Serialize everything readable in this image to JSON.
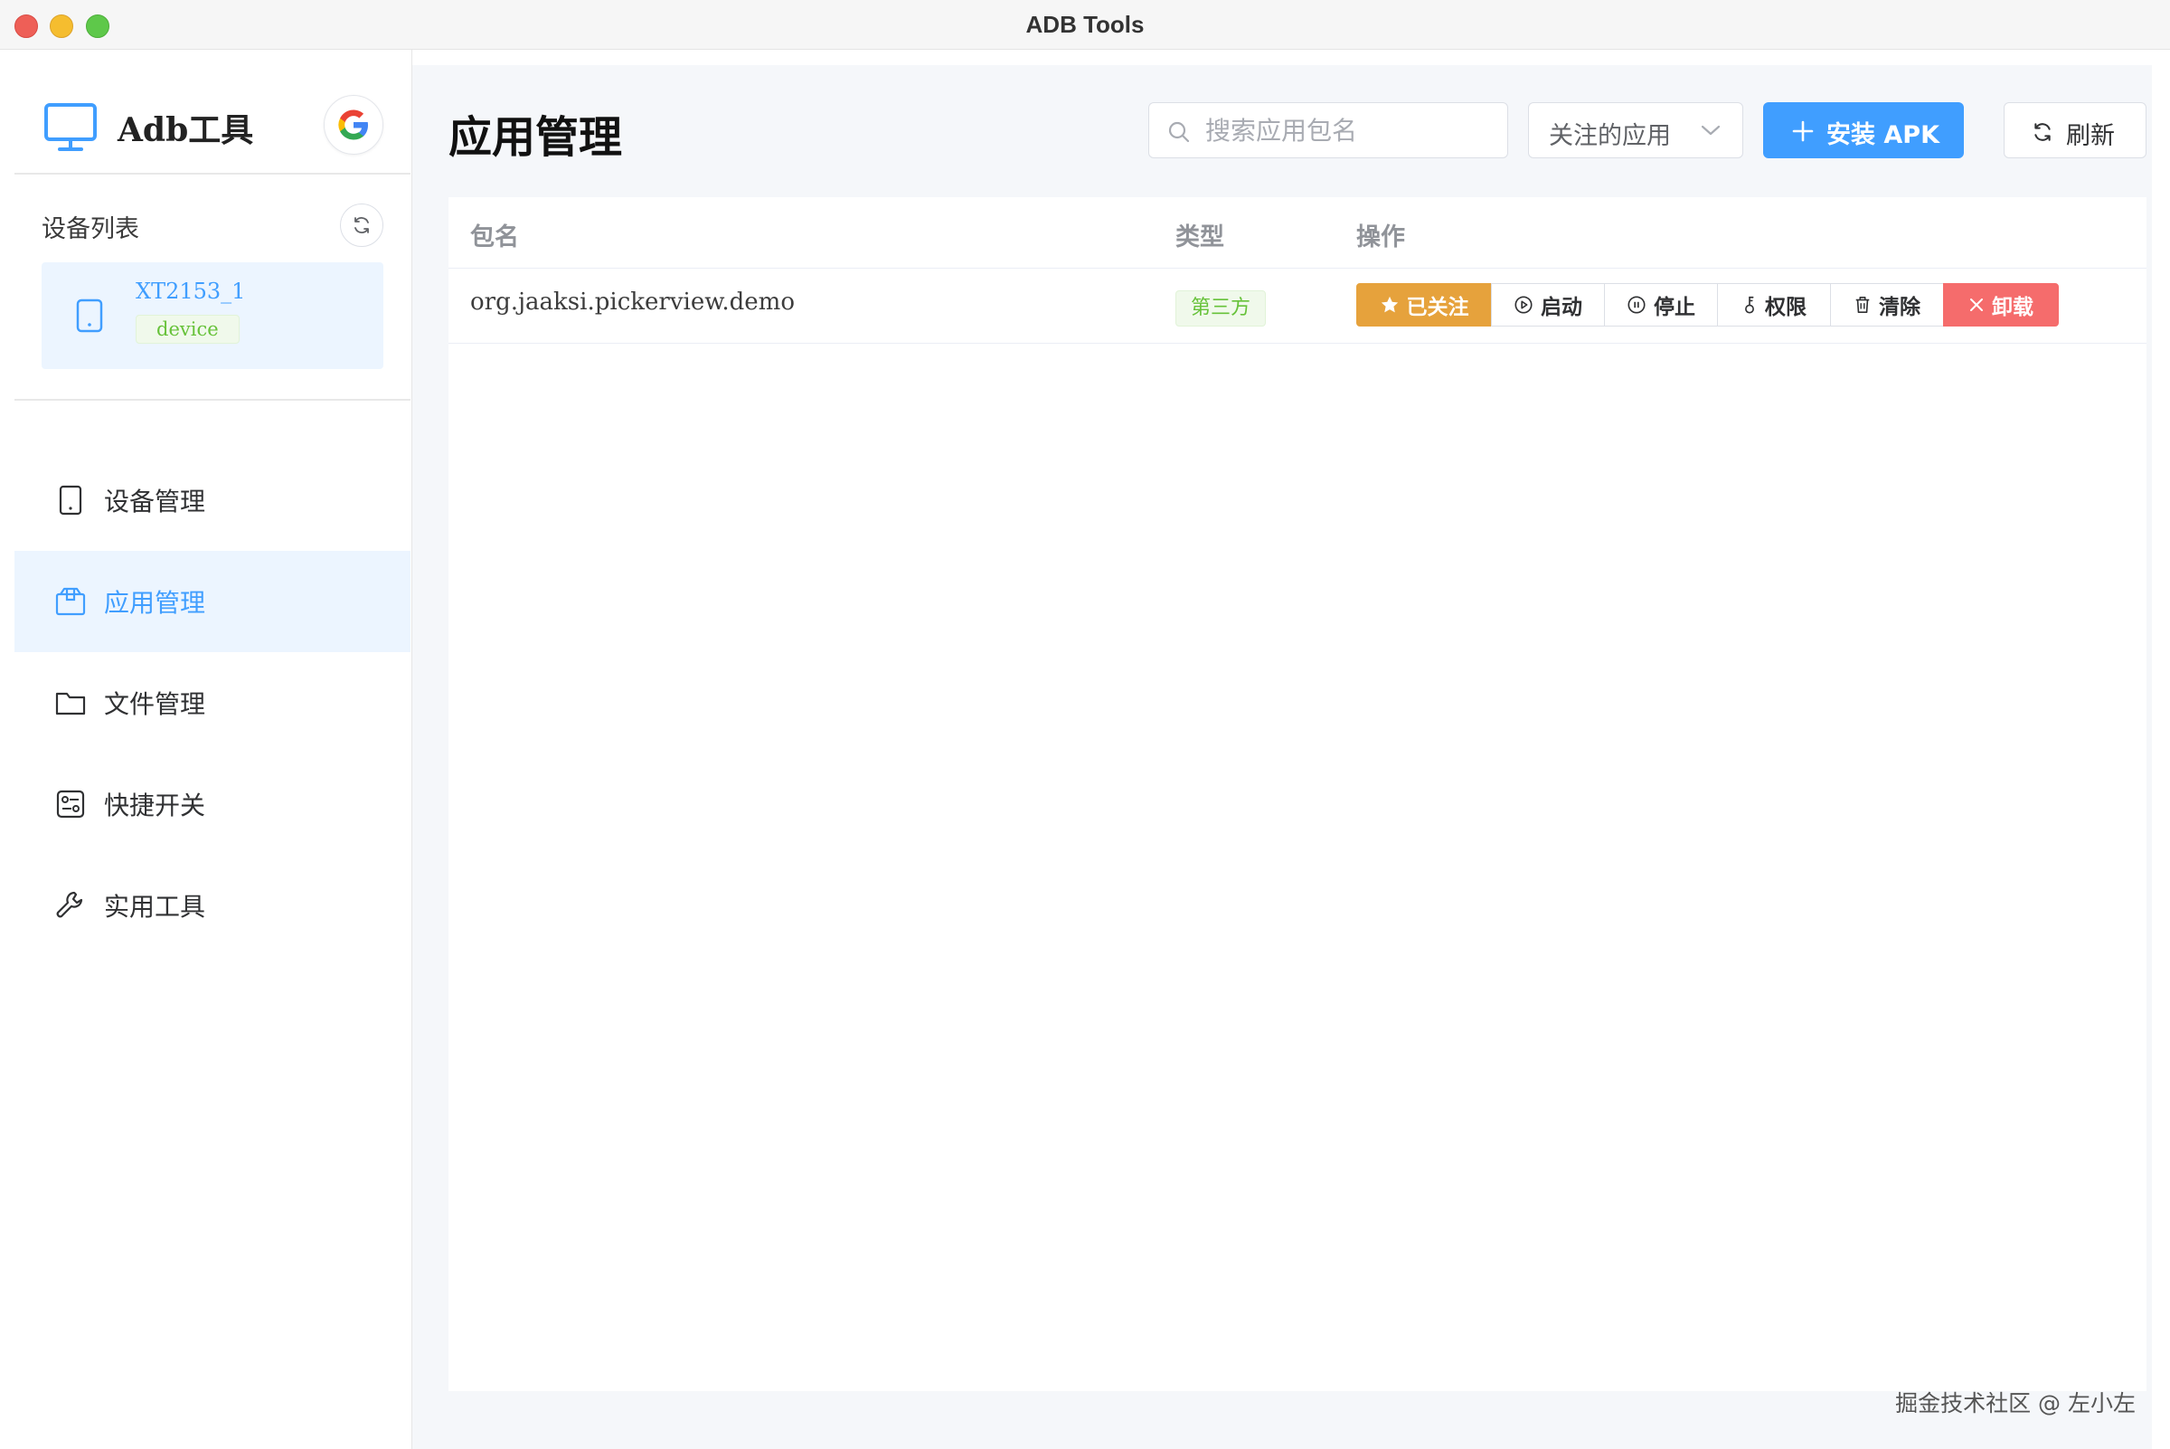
{
  "window": {
    "title": "ADB Tools"
  },
  "sidebar": {
    "brand": "Adb工具",
    "device_list_title": "设备列表",
    "devices": [
      {
        "name": "XT2153_1",
        "state": "device"
      }
    ],
    "menu": [
      {
        "label": "设备管理",
        "icon": "tablet-icon",
        "active": false
      },
      {
        "label": "应用管理",
        "icon": "package-icon",
        "active": true
      },
      {
        "label": "文件管理",
        "icon": "folder-icon",
        "active": false
      },
      {
        "label": "快捷开关",
        "icon": "switches-icon",
        "active": false
      },
      {
        "label": "实用工具",
        "icon": "wrench-icon",
        "active": false
      }
    ]
  },
  "main": {
    "title": "应用管理",
    "search": {
      "placeholder": "搜索应用包名",
      "value": ""
    },
    "filter": {
      "selected": "关注的应用"
    },
    "install_label": "安装 APK",
    "refresh_label": "刷新",
    "table": {
      "headers": {
        "package": "包名",
        "type": "类型",
        "actions": "操作"
      },
      "rows": [
        {
          "package": "org.jaaksi.pickerview.demo",
          "type": "第三方",
          "actions": {
            "followed": "已关注",
            "start": "启动",
            "stop": "停止",
            "permissions": "权限",
            "clear": "清除",
            "uninstall": "卸载"
          }
        }
      ]
    }
  },
  "watermark": "掘金技术社区 @ 左小左",
  "colors": {
    "primary": "#409eff",
    "warning": "#e6a23c",
    "danger": "#f56c6c",
    "success": "#67c23a",
    "active_bg": "#ecf5ff"
  }
}
